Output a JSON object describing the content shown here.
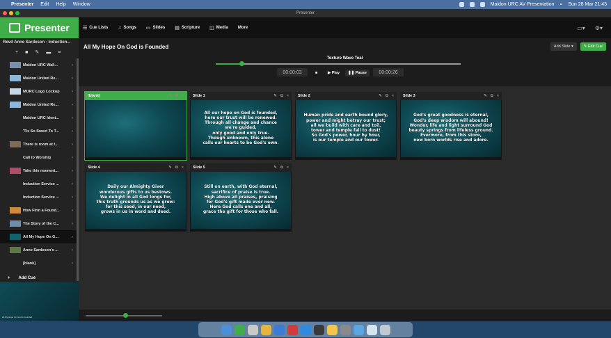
{
  "menubar": {
    "app": "Presenter",
    "items": [
      "Edit",
      "Help",
      "Window"
    ],
    "status_text": "Maldon URC AV Presentation",
    "clock": "Sun 28 Mar 21:43"
  },
  "window": {
    "title": "Presenter"
  },
  "header": {
    "logo": "Presenter",
    "nav": [
      {
        "label": "Cue Lists",
        "icon": "list-icon"
      },
      {
        "label": "Songs",
        "icon": "music-icon"
      },
      {
        "label": "Slides",
        "icon": "slides-icon"
      },
      {
        "label": "Scripture",
        "icon": "book-icon"
      },
      {
        "label": "Media",
        "icon": "media-icon"
      },
      {
        "label": "More",
        "icon": ""
      }
    ],
    "right_icons": [
      "display-icon",
      "gear-icon"
    ]
  },
  "sidebar": {
    "title": "Revd Anne Sardeson - Induction...",
    "items": [
      {
        "label": "Maldon URC Wall...",
        "thumb": "#7a8fae"
      },
      {
        "label": "Maldon United Re...",
        "thumb": "#8fb6d6"
      },
      {
        "label": "MURC Logo Lockup",
        "thumb": "#c7d7e6"
      },
      {
        "label": "Maldon United Re...",
        "thumb": "#8fb6d6"
      },
      {
        "label": "Maldon URC Ident...",
        "thumb": ""
      },
      {
        "label": "'Tis So Sweet To T...",
        "thumb": ""
      },
      {
        "label": "There is room at t...",
        "thumb": "#7d6b58"
      },
      {
        "label": "Call to Worship",
        "thumb": ""
      },
      {
        "label": "Take this moment...",
        "thumb": "#b04b6a"
      },
      {
        "label": "Induction Service ...",
        "thumb": ""
      },
      {
        "label": "Induction Service ...",
        "thumb": ""
      },
      {
        "label": "How Firm a Found...",
        "thumb": "#d08a3a"
      },
      {
        "label": "The Story of the C...",
        "thumb": "#6f8eae"
      },
      {
        "label": "All My Hope On G...",
        "thumb": "#14616b",
        "active": true
      },
      {
        "label": "Anne Sardeson's ...",
        "thumb": "#5d7a45"
      },
      {
        "label": "[blank]",
        "thumb": ""
      }
    ],
    "add_cue": "Add Cue",
    "preview_text": "All My Hope On God is Founded"
  },
  "main": {
    "cue_title": "All My Hope On God is Founded",
    "add_slide": "Add Slide",
    "edit_cue": "Edit Cue",
    "background_name": "Texture Wave Teal",
    "progress": 0.105,
    "elapsed": "00:00:03",
    "remaining": "00:00:26",
    "play": "Play",
    "pause": "Pause",
    "zoom": 0.52
  },
  "slides": [
    {
      "label": "[blank]",
      "text": "",
      "active": true
    },
    {
      "label": "Slide 1",
      "text": "All our hope on God is founded,\nhere our trust will be renewed.\nThrough all change and chance\nwe're guided,\nonly good and only true.\nThough unknown, this alone\ncalls our hearts to be God's own."
    },
    {
      "label": "Slide 2",
      "text": "Human pride and earth bound glory,\npower and might betray our trust;\nall we build with care and toil,\ntower and temple fall to dust!\nSo God's power, hour by hour,\nis our temple and our tower."
    },
    {
      "label": "Slide 3",
      "text": "God's great goodness is eternal,\nGod's deep wisdom will abound!\nWonder, life and light surround God\nbeauty springs from lifeless ground.\nEvermore, from this store,\nnew born worlds rise and adore."
    },
    {
      "label": "Slide 4",
      "text": "Daily our Almighty Giver\nwonderous gifts to us bestows.\nWe delight in all God longs for,\nthis truth grounds us as we grow:\nfor this seed, in our need,\ngrows in us in word and deed."
    },
    {
      "label": "Slide 5",
      "text": "Still on earth, with God eternal,\nsacrifice of praise is true.\nHigh above all praises, praising\nfor God's gift made ever new.\nHere God calls one and all,\ngrace the gift for those who fall."
    }
  ],
  "dock": {
    "icons": [
      "finder-icon",
      "presenter-icon",
      "photos-icon",
      "chrome-icon",
      "mail-icon",
      "opera-icon",
      "messenger-icon",
      "obs-icon",
      "emoji-icon",
      "settings-icon",
      "screen-icon",
      "finder-window-icon",
      "trash-icon"
    ]
  }
}
